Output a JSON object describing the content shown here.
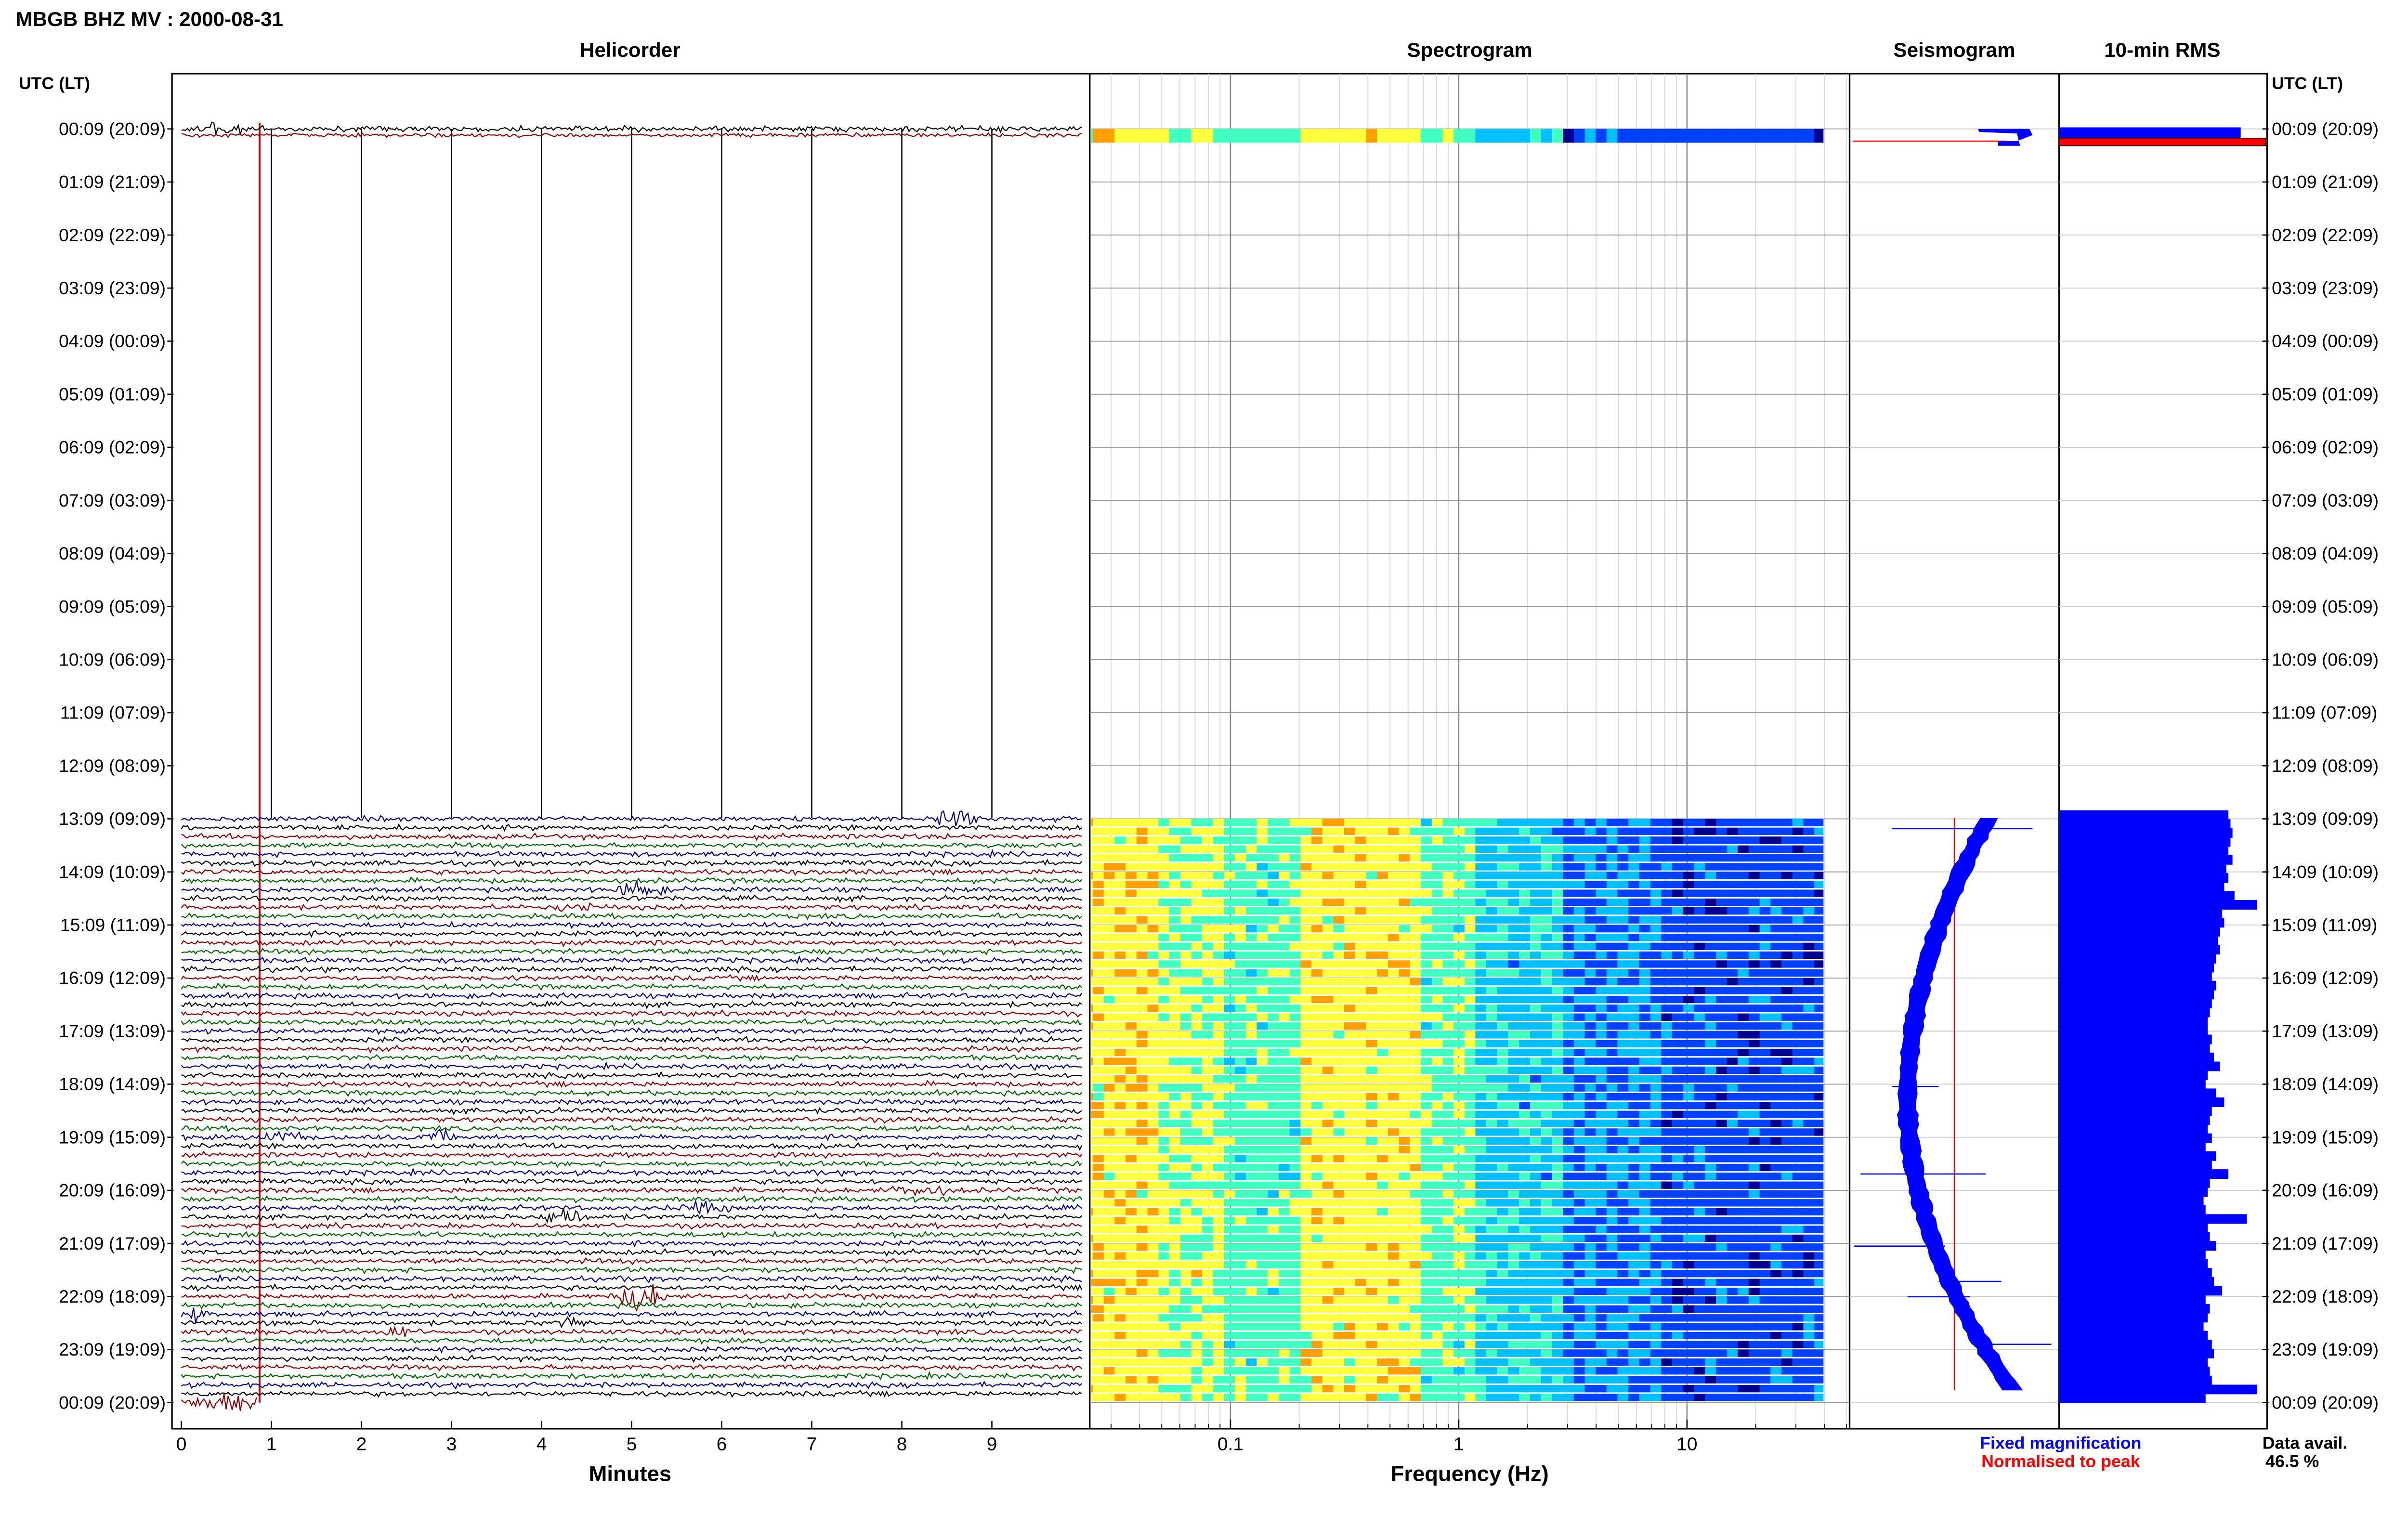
{
  "title": "MBGB BHZ MV : 2000-08-31",
  "panels": {
    "helicorder": "Helicorder",
    "spectrogram": "Spectrogram",
    "seismogram": "Seismogram",
    "rms": "10-min RMS"
  },
  "time_header": "UTC (LT)",
  "time_labels": [
    "00:09 (20:09)",
    "01:09 (21:09)",
    "02:09 (22:09)",
    "03:09 (23:09)",
    "04:09 (00:09)",
    "05:09 (01:09)",
    "06:09 (02:09)",
    "07:09 (03:09)",
    "08:09 (04:09)",
    "09:09 (05:09)",
    "10:09 (06:09)",
    "11:09 (07:09)",
    "12:09 (08:09)",
    "13:09 (09:09)",
    "14:09 (10:09)",
    "15:09 (11:09)",
    "16:09 (12:09)",
    "17:09 (13:09)",
    "18:09 (14:09)",
    "19:09 (15:09)",
    "20:09 (16:09)",
    "21:09 (17:09)",
    "22:09 (18:09)",
    "23:09 (19:09)",
    "00:09 (20:09)"
  ],
  "xaxis": {
    "helicorder_label": "Minutes",
    "helicorder_ticks": [
      "0",
      "1",
      "2",
      "3",
      "4",
      "5",
      "6",
      "7",
      "8",
      "9"
    ],
    "spectrogram_label": "Frequency (Hz)",
    "spectrogram_ticks": [
      "0.1",
      "1",
      "10"
    ]
  },
  "legend": {
    "fixed": "Fixed magnification",
    "normalised": "Normalised to peak",
    "fixed_color": "#0000ff",
    "normalised_color": "#ff0000"
  },
  "data_avail": {
    "label": "Data avail.",
    "value": "46.5 %"
  },
  "colors": {
    "trace_cycle": [
      "#000000",
      "#8b0000",
      "#006400",
      "#00008b"
    ],
    "rms_bar": "#0000ff",
    "rms_bar_outline": "#000000",
    "rms_highlight": "#ff0000",
    "seismogram_trace": "#0000ff",
    "spectrogram_scale": [
      "#00008f",
      "#0040ff",
      "#00c0ff",
      "#40ffc0",
      "#ffff40",
      "#ffa000",
      "#ff2000"
    ]
  },
  "chart_data": {
    "type": "heatmap",
    "rows_per_hour": 6,
    "hours": 24,
    "data_present_hours": [
      "00:09",
      "13:09",
      "14:09",
      "15:09",
      "16:09",
      "17:09",
      "18:09",
      "19:09",
      "20:09",
      "21:09",
      "22:09",
      "23:09"
    ],
    "helicorder_minutes_range": [
      0,
      10
    ],
    "spectrogram_freq_range_hz": [
      0.02,
      40
    ],
    "spectrogram_freq_scale": "log",
    "rms_relative_values": [
      0.88,
      1.0,
      0.82,
      0.83,
      0.84,
      0.83,
      0.82,
      0.84,
      0.81,
      0.82,
      0.8,
      0.85,
      0.96,
      0.79,
      0.8,
      0.78,
      0.77,
      0.78,
      0.76,
      0.75,
      0.74,
      0.76,
      0.75,
      0.74,
      0.73,
      0.72,
      0.72,
      0.74,
      0.73,
      0.75,
      0.78,
      0.72,
      0.71,
      0.76,
      0.8,
      0.74,
      0.73,
      0.72,
      0.74,
      0.71,
      0.76,
      0.74,
      0.82,
      0.73,
      0.72,
      0.7,
      0.71,
      0.91,
      0.72,
      0.73,
      0.76,
      0.71,
      0.72,
      0.74,
      0.75,
      0.79,
      0.71,
      0.73,
      0.72,
      0.7,
      0.72,
      0.74,
      0.75,
      0.72,
      0.73,
      0.74,
      0.96,
      0.71
    ]
  }
}
